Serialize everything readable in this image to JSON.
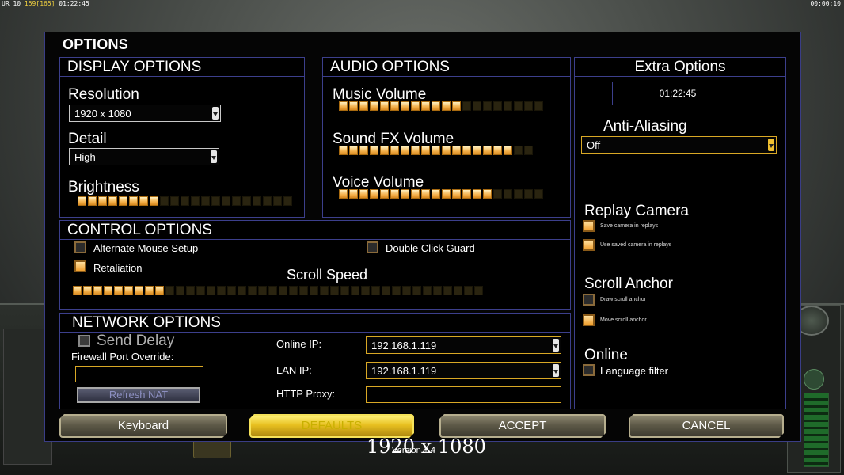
{
  "hud": {
    "top_left_prefix": "UR 10",
    "top_left_res": "159[165]",
    "top_left_time": "01:22:45",
    "top_right_time": "00:00:10"
  },
  "options": {
    "title": "OPTIONS",
    "display": {
      "header": "DISPLAY OPTIONS",
      "resolution_label": "Resolution",
      "resolution_value": "1920 x 1080",
      "detail_label": "Detail",
      "detail_value": "High",
      "brightness_label": "Brightness",
      "brightness_level": 8,
      "brightness_segments": 21
    },
    "audio": {
      "header": "AUDIO OPTIONS",
      "music_label": "Music Volume",
      "music_level": 12,
      "music_segments": 20,
      "sfx_label": "Sound FX Volume",
      "sfx_level": 17,
      "sfx_segments": 19,
      "voice_label": "Voice Volume",
      "voice_level": 15,
      "voice_segments": 20
    },
    "extra": {
      "header": "Extra Options",
      "clock": "01:22:45",
      "anti_aliasing_label": "Anti-Aliasing",
      "anti_aliasing_value": "Off",
      "replay_camera_label": "Replay Camera",
      "save_camera_label": "Save camera in replays",
      "save_camera_checked": true,
      "use_saved_camera_label": "Use saved camera in replays",
      "use_saved_camera_checked": true,
      "scroll_anchor_label": "Scroll Anchor",
      "draw_scroll_anchor_label": "Draw scroll anchor",
      "draw_scroll_anchor_checked": false,
      "move_scroll_anchor_label": "Move scroll anchor",
      "move_scroll_anchor_checked": true,
      "online_label": "Online",
      "language_filter_label": "Language filter",
      "language_filter_checked": false
    },
    "control": {
      "header": "CONTROL OPTIONS",
      "alt_mouse_label": "Alternate Mouse Setup",
      "alt_mouse_checked": false,
      "double_click_label": "Double Click Guard",
      "double_click_checked": false,
      "retaliation_label": "Retaliation",
      "retaliation_checked": true,
      "scroll_speed_label": "Scroll Speed",
      "scroll_speed_level": 9,
      "scroll_speed_segments": 40
    },
    "network": {
      "header": "NETWORK OPTIONS",
      "send_delay_label": "Send Delay",
      "firewall_label": "Firewall Port Override:",
      "firewall_value": "",
      "refresh_nat_label": "Refresh NAT",
      "online_ip_label": "Online IP:",
      "online_ip_value": "192.168.1.119",
      "lan_ip_label": "LAN IP:",
      "lan_ip_value": "192.168.1.119",
      "http_proxy_label": "HTTP Proxy:",
      "http_proxy_value": ""
    },
    "buttons": {
      "keyboard": "Keyboard",
      "defaults": "DEFAULTS",
      "accept": "ACCEPT",
      "cancel": "CANCEL"
    }
  },
  "overlay": {
    "resolution_text": "1920 x 1080",
    "version_text": "Version 1.4"
  },
  "colors": {
    "frame_border": "#3c3f8c",
    "slider_on": "#f3b04a",
    "dropdown_gold": "#d9a825"
  }
}
